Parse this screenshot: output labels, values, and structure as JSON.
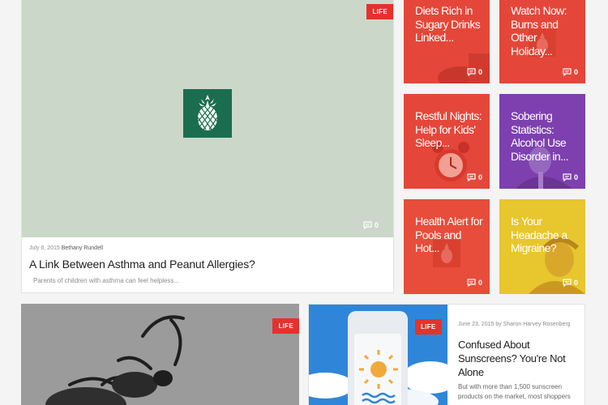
{
  "featured": {
    "tag": "LIFE",
    "comments": "0",
    "date": "July 6, 2015",
    "author": "Bethany Rundell",
    "headline": "A Link Between Asthma and Peanut Allergies?",
    "summary": "Parents of children with asthma can feel helpless..."
  },
  "tiles": [
    {
      "title": "Diets Rich in Sugary Drinks Linked...",
      "comments": "0"
    },
    {
      "title": "Watch Now: Burns and Other Holiday...",
      "comments": "0"
    },
    {
      "title": "Restful Nights: Help for Kids' Sleep...",
      "comments": "0"
    },
    {
      "title": "Sobering Statistics: Alcohol Use Disorder in...",
      "comments": "0"
    },
    {
      "title": "Health Alert for Pools and Hot...",
      "comments": "0"
    },
    {
      "title": "Is Your Headache a Migraine?",
      "comments": "0"
    }
  ],
  "bottom_left": {
    "tag": "LIFE"
  },
  "bottom_right": {
    "tag": "LIFE",
    "date": "June 23, 2015",
    "author": "Sharon Harvey Rosenberg",
    "headline": "Confused About Sunscreens? You're Not Alone",
    "summary": "But with more than 1,500 sunscreen products on the market, most shoppers"
  },
  "colors": {
    "tag": "#e5322d",
    "tile_red": "#e4473a",
    "tile_purple": "#7d40ae",
    "tile_yellow": "#e8c62e",
    "brand_green": "#1a6e4f"
  },
  "icons": {
    "comment": "speech-bubble-icon",
    "logo": "pineapple-logo"
  }
}
